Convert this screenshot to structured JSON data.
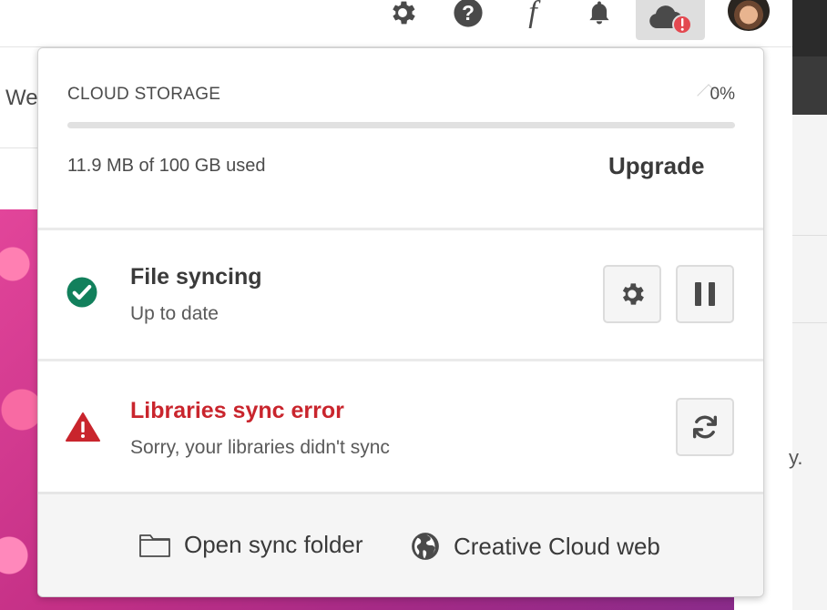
{
  "page": {
    "left_heading_fragment": "We",
    "right_fragment": "y."
  },
  "topbar": {
    "icons": [
      "gear-icon",
      "help-icon",
      "font-icon",
      "bell-icon",
      "cloud-error-icon",
      "avatar"
    ]
  },
  "popover": {
    "storage": {
      "label": "CLOUD STORAGE",
      "percent": "0%",
      "percent_value": 0,
      "used_text": "11.9 MB of 100 GB used",
      "upgrade_label": "Upgrade"
    },
    "file_sync": {
      "title": "File syncing",
      "status": "Up to date",
      "status_icon": "check-circle-icon",
      "actions": [
        "gear-icon",
        "pause-icon"
      ]
    },
    "libraries": {
      "title": "Libraries sync error",
      "message": "Sorry, your libraries didn't sync",
      "status_icon": "alert-triangle-icon",
      "actions": [
        "refresh-icon"
      ]
    },
    "footer": {
      "open_folder_label": "Open sync folder",
      "web_label": "Creative Cloud web"
    }
  },
  "colors": {
    "success": "#12805c",
    "error": "#c9252d",
    "badge": "#e34850",
    "progress": "#2680eb"
  }
}
